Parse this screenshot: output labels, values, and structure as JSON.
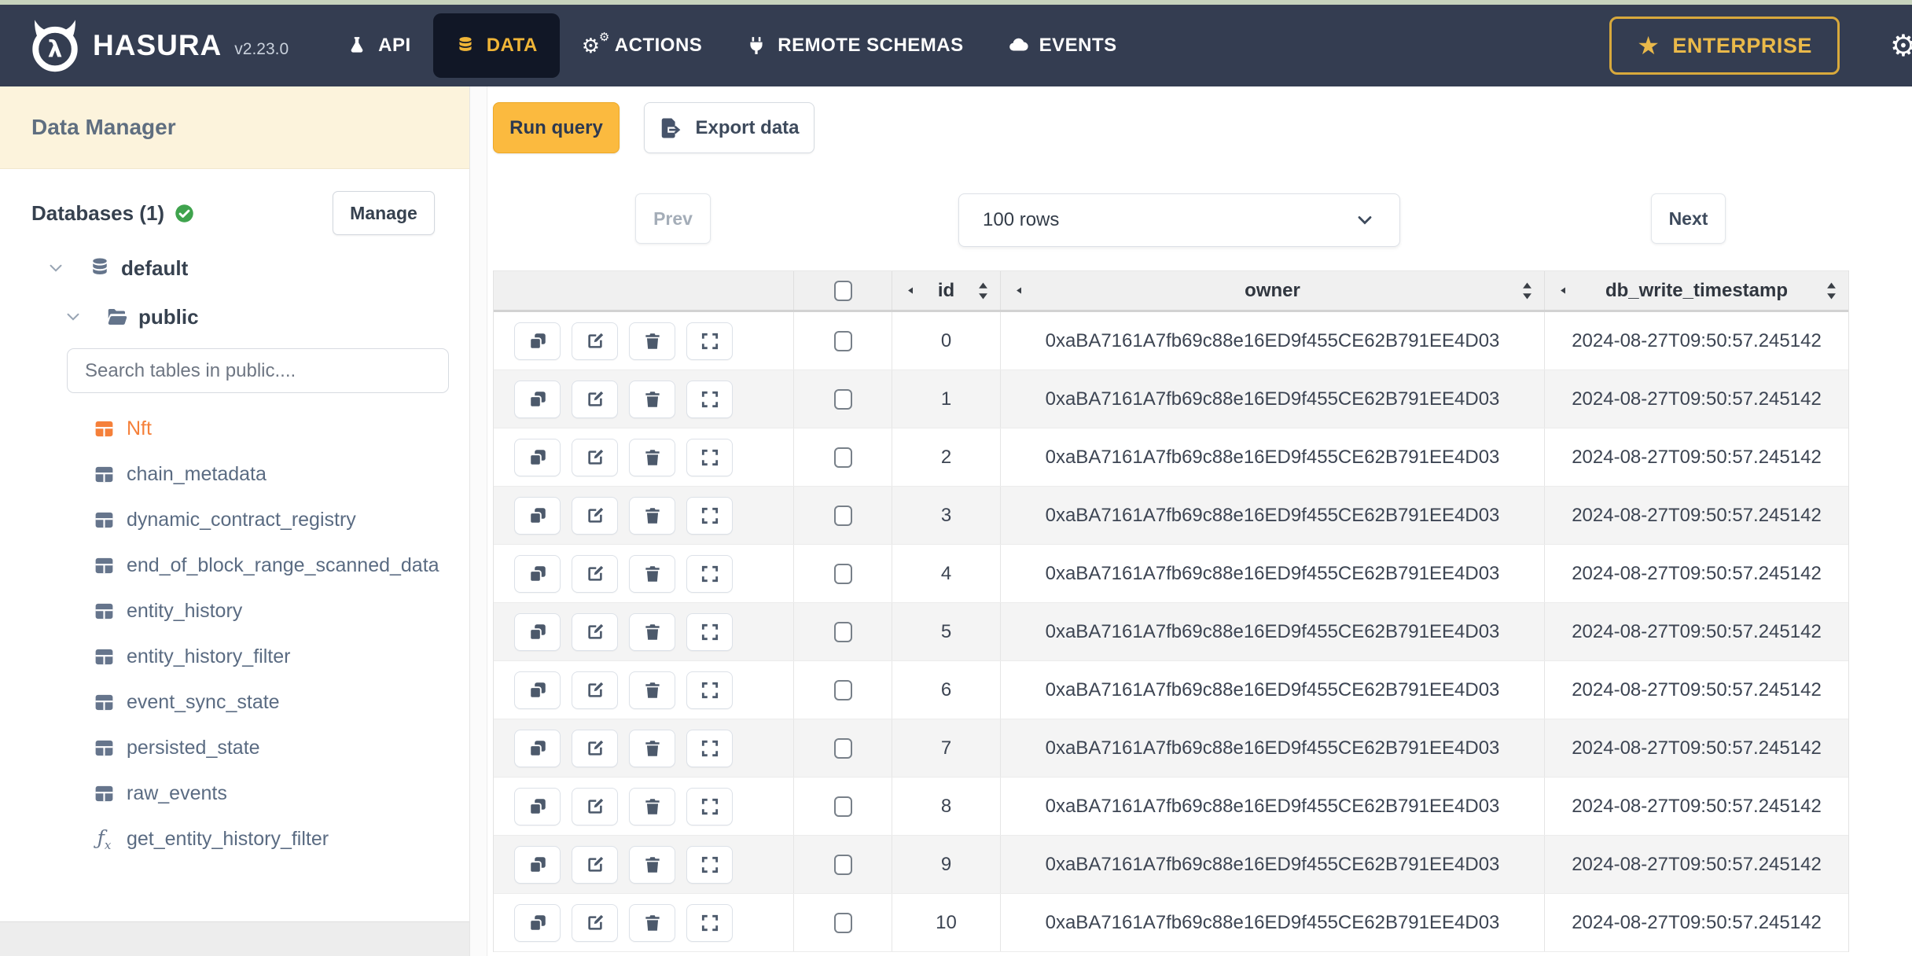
{
  "nav": {
    "brand": "HASURA",
    "version": "v2.23.0",
    "items": [
      {
        "label": "API",
        "icon": "flask-icon",
        "active": false
      },
      {
        "label": "DATA",
        "icon": "database-icon",
        "active": true
      },
      {
        "label": "ACTIONS",
        "icon": "gears-icon",
        "active": false
      },
      {
        "label": "REMOTE SCHEMAS",
        "icon": "plug-icon",
        "active": false
      },
      {
        "label": "EVENTS",
        "icon": "cloud-icon",
        "active": false
      }
    ],
    "enterprise_label": "ENTERPRISE"
  },
  "sidebar": {
    "title": "Data Manager",
    "databases_label": "Databases (1)",
    "manage_label": "Manage",
    "tree": {
      "database": "default",
      "schema": "public"
    },
    "search_placeholder": "Search tables in public....",
    "selected_table": "Nft",
    "tables": [
      "Nft",
      "chain_metadata",
      "dynamic_contract_registry",
      "end_of_block_range_scanned_data",
      "entity_history",
      "entity_history_filter",
      "event_sync_state",
      "persisted_state",
      "raw_events"
    ],
    "function_item": "get_entity_history_filter"
  },
  "toolbar": {
    "run_query": "Run query",
    "export_data": "Export data"
  },
  "pagination": {
    "prev": "Prev",
    "rows": "100 rows",
    "next": "Next"
  },
  "table": {
    "columns": [
      "id",
      "owner",
      "db_write_timestamp"
    ],
    "rows": [
      {
        "id": "0",
        "owner": "0xaBA7161A7fb69c88e16ED9f455CE62B791EE4D03",
        "db_write_timestamp": "2024-08-27T09:50:57.245142"
      },
      {
        "id": "1",
        "owner": "0xaBA7161A7fb69c88e16ED9f455CE62B791EE4D03",
        "db_write_timestamp": "2024-08-27T09:50:57.245142"
      },
      {
        "id": "2",
        "owner": "0xaBA7161A7fb69c88e16ED9f455CE62B791EE4D03",
        "db_write_timestamp": "2024-08-27T09:50:57.245142"
      },
      {
        "id": "3",
        "owner": "0xaBA7161A7fb69c88e16ED9f455CE62B791EE4D03",
        "db_write_timestamp": "2024-08-27T09:50:57.245142"
      },
      {
        "id": "4",
        "owner": "0xaBA7161A7fb69c88e16ED9f455CE62B791EE4D03",
        "db_write_timestamp": "2024-08-27T09:50:57.245142"
      },
      {
        "id": "5",
        "owner": "0xaBA7161A7fb69c88e16ED9f455CE62B791EE4D03",
        "db_write_timestamp": "2024-08-27T09:50:57.245142"
      },
      {
        "id": "6",
        "owner": "0xaBA7161A7fb69c88e16ED9f455CE62B791EE4D03",
        "db_write_timestamp": "2024-08-27T09:50:57.245142"
      },
      {
        "id": "7",
        "owner": "0xaBA7161A7fb69c88e16ED9f455CE62B791EE4D03",
        "db_write_timestamp": "2024-08-27T09:50:57.245142"
      },
      {
        "id": "8",
        "owner": "0xaBA7161A7fb69c88e16ED9f455CE62B791EE4D03",
        "db_write_timestamp": "2024-08-27T09:50:57.245142"
      },
      {
        "id": "9",
        "owner": "0xaBA7161A7fb69c88e16ED9f455CE62B791EE4D03",
        "db_write_timestamp": "2024-08-27T09:50:57.245142"
      },
      {
        "id": "10",
        "owner": "0xaBA7161A7fb69c88e16ED9f455CE62B791EE4D03",
        "db_write_timestamp": "2024-08-27T09:50:57.245142"
      }
    ]
  },
  "colors": {
    "nav_bg": "#343d51",
    "nav_active_bg": "#111726",
    "accent_yellow": "#f0b537",
    "run_query_yellow": "#fbba3f",
    "sidebar_header_bg": "#fcf3dc",
    "selected_table_orange": "#f5803a",
    "success_green": "#3fa34d",
    "table_header_bg": "#f0f0f0",
    "row_alt_bg": "#f4f4f4",
    "top_strip_green": "#c7d3bd"
  }
}
